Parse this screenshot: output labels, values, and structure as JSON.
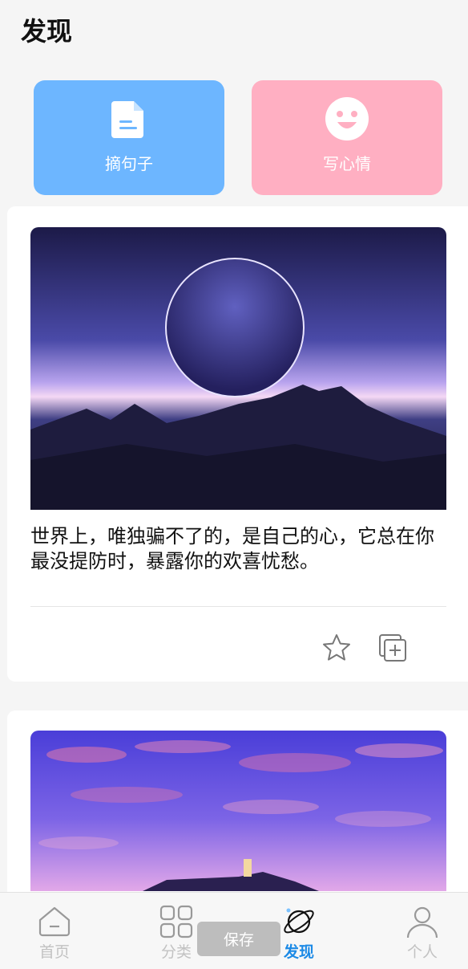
{
  "header": {
    "title": "发现"
  },
  "actions": {
    "quote": {
      "label": "摘句子",
      "icon": "document-icon",
      "color": "#6db6ff"
    },
    "mood": {
      "label": "写心情",
      "icon": "smile-icon",
      "color": "#ffafc2"
    }
  },
  "feed": [
    {
      "image": "planet-over-mountains",
      "text": "世界上，唯独骗不了的，是自己的心，它总在你最没提防时，暴露你的欢喜忧愁。"
    },
    {
      "image": "pink-flower-sky"
    }
  ],
  "tabbar": {
    "items": [
      {
        "label": "首页",
        "icon": "home-icon"
      },
      {
        "label": "分类",
        "icon": "grid-icon"
      },
      {
        "label": "发现",
        "icon": "planet-icon",
        "active": true
      },
      {
        "label": "个人",
        "icon": "person-icon"
      }
    ],
    "active_color": "#1c8ae6"
  },
  "toast": {
    "text": "保存"
  }
}
